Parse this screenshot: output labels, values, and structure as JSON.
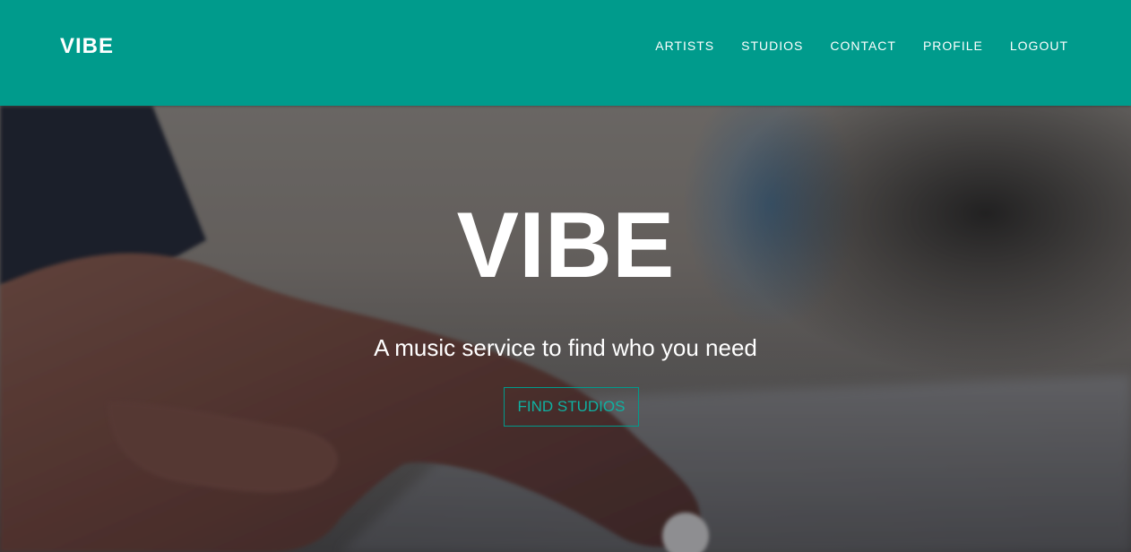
{
  "nav": {
    "brand": "VIBE",
    "links": [
      {
        "label": "ARTISTS"
      },
      {
        "label": "STUDIOS"
      },
      {
        "label": "CONTACT"
      },
      {
        "label": "PROFILE"
      },
      {
        "label": "LOGOUT"
      }
    ]
  },
  "hero": {
    "title": "VIBE",
    "subtitle": "A music service to find who you need",
    "button_label": "FIND STUDIOS",
    "background_image": "hand-on-mixing-console-photo"
  },
  "colors": {
    "nav_background": "#009b8c",
    "accent": "#009b8c",
    "button_text": "#0fb1a2",
    "text_light": "#ffffff"
  }
}
